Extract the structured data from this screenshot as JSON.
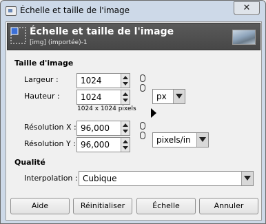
{
  "window": {
    "title": "Échelle et taille de l'image",
    "close_glyph": "✕"
  },
  "header": {
    "title": "Échelle et taille de l'image",
    "subtitle": "[img] (importée)-1"
  },
  "image_size": {
    "section_title": "Taille d'image",
    "width_label": "Largeur :",
    "width_value": "1024",
    "height_label": "Hauteur :",
    "height_value": "1024",
    "size_hint": "1024 x 1024 pixels",
    "unit": "px",
    "res_x_label": "Résolution X :",
    "res_x_value": "96,000",
    "res_y_label": "Résolution Y :",
    "res_y_value": "96,000",
    "res_unit": "pixels/in"
  },
  "quality": {
    "section_title": "Qualité",
    "interp_label": "Interpolation :",
    "interp_value": "Cubique"
  },
  "buttons": {
    "help": "Aide",
    "reset": "Réinitialiser",
    "scale": "Échelle",
    "cancel": "Annuler"
  },
  "icons": {
    "app": "scale-image-icon",
    "close": "close-icon",
    "chain": "chain-link-icon",
    "dropdown": "chevron-down-icon"
  }
}
